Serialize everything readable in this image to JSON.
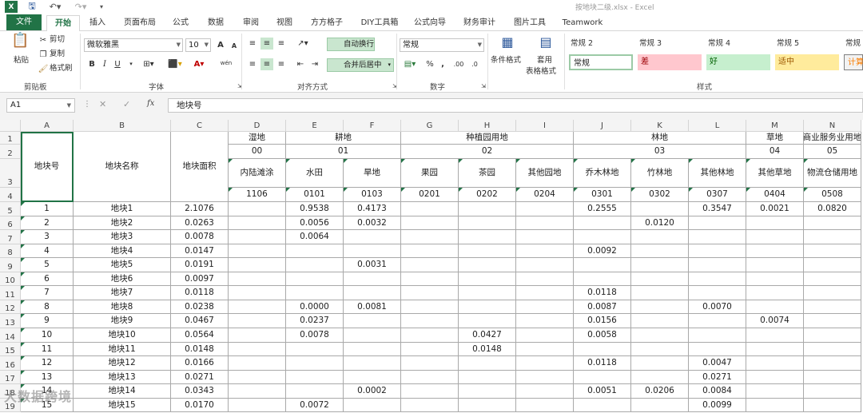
{
  "title_bar": {
    "window_title": "按地块二级.xlsx - Excel",
    "quick_access": [
      "excel-logo-icon",
      "save-icon",
      "undo-icon",
      "redo-icon",
      "customize-icon"
    ]
  },
  "ribbon_tabs": [
    "文件",
    "开始",
    "插入",
    "页面布局",
    "公式",
    "数据",
    "审阅",
    "视图",
    "方方格子",
    "DIY工具箱",
    "公式向导",
    "财务审计",
    "图片工具",
    "Teamwork"
  ],
  "ribbon": {
    "clipboard": {
      "paste": "粘贴",
      "cut": "剪切",
      "copy": "复制",
      "format_painter": "格式刷",
      "group_label": "剪贴板"
    },
    "font": {
      "name": "微软雅黑",
      "size": "10",
      "group_label": "字体",
      "bold": "B",
      "italic": "I",
      "underline": "U",
      "grow": "A",
      "shrink": "A",
      "wen": "wén"
    },
    "alignment": {
      "wrap": "自动换行",
      "merge": "合并后居中",
      "group_label": "对齐方式"
    },
    "number": {
      "format": "常规",
      "percent": "%",
      "comma": ",",
      "group_label": "数字"
    },
    "styles": {
      "conditional": "条件格式",
      "table": "套用",
      "table2": "表格格式",
      "group_label": "样式",
      "headers": [
        "常规 2",
        "常规 3",
        "常规 4",
        "常规 5",
        "常规"
      ],
      "cells": [
        {
          "label": "常规",
          "bg": "#ffffff",
          "color": "#222222"
        },
        {
          "label": "差",
          "bg": "#ffc7ce",
          "color": "#9c0006"
        },
        {
          "label": "好",
          "bg": "#c6efce",
          "color": "#006100"
        },
        {
          "label": "适中",
          "bg": "#ffeb9c",
          "color": "#9c5700"
        },
        {
          "label": "计算",
          "bg": "#f2f2f2",
          "color": "#fa7d00"
        }
      ]
    }
  },
  "formula_bar": {
    "name_box": "A1",
    "fx": "fx",
    "formula": "地块号"
  },
  "columns": [
    "A",
    "B",
    "C",
    "D",
    "E",
    "F",
    "G",
    "H",
    "I",
    "J",
    "K",
    "L",
    "M",
    "N"
  ],
  "rows": [
    "1",
    "2",
    "3",
    "4",
    "5",
    "6",
    "7",
    "8",
    "9",
    "10",
    "11",
    "12",
    "13",
    "14",
    "15",
    "16",
    "17",
    "18",
    "19"
  ],
  "header": {
    "a": "地块号",
    "b": "地块名称",
    "c": "地块面积",
    "row1": [
      "湿地",
      "耕地",
      "种植园用地",
      "林地",
      "草地",
      "商业服务业用地"
    ],
    "row2": [
      "00",
      "01",
      "02",
      "03",
      "04",
      "05"
    ],
    "row3": [
      "内陆滩涂",
      "水田",
      "旱地",
      "果园",
      "茶园",
      "其他园地",
      "乔木林地",
      "竹林地",
      "其他林地",
      "其他草地",
      "物流仓储用地"
    ],
    "row4": [
      "1106",
      "0101",
      "0103",
      "0201",
      "0202",
      "0204",
      "0301",
      "0302",
      "0307",
      "0404",
      "0508"
    ]
  },
  "data_rows": [
    [
      "1",
      "地块1",
      "2.1076",
      "",
      "0.9538",
      "0.4173",
      "",
      "",
      "",
      "0.2555",
      "",
      "0.3547",
      "0.0021",
      "0.0820"
    ],
    [
      "2",
      "地块2",
      "0.0263",
      "",
      "0.0056",
      "0.0032",
      "",
      "",
      "",
      "",
      "0.0120",
      "",
      "",
      ""
    ],
    [
      "3",
      "地块3",
      "0.0078",
      "",
      "0.0064",
      "",
      "",
      "",
      "",
      "",
      "",
      "",
      "",
      ""
    ],
    [
      "4",
      "地块4",
      "0.0147",
      "",
      "",
      "",
      "",
      "",
      "",
      "0.0092",
      "",
      "",
      "",
      ""
    ],
    [
      "5",
      "地块5",
      "0.0191",
      "",
      "",
      "0.0031",
      "",
      "",
      "",
      "",
      "",
      "",
      "",
      ""
    ],
    [
      "6",
      "地块6",
      "0.0097",
      "",
      "",
      "",
      "",
      "",
      "",
      "",
      "",
      "",
      "",
      ""
    ],
    [
      "7",
      "地块7",
      "0.0118",
      "",
      "",
      "",
      "",
      "",
      "",
      "0.0118",
      "",
      "",
      "",
      ""
    ],
    [
      "8",
      "地块8",
      "0.0238",
      "",
      "0.0000",
      "0.0081",
      "",
      "",
      "",
      "0.0087",
      "",
      "0.0070",
      "",
      ""
    ],
    [
      "9",
      "地块9",
      "0.0467",
      "",
      "0.0237",
      "",
      "",
      "",
      "",
      "0.0156",
      "",
      "",
      "0.0074",
      ""
    ],
    [
      "10",
      "地块10",
      "0.0564",
      "",
      "0.0078",
      "",
      "",
      "0.0427",
      "",
      "0.0058",
      "",
      "",
      "",
      ""
    ],
    [
      "11",
      "地块11",
      "0.0148",
      "",
      "",
      "",
      "",
      "0.0148",
      "",
      "",
      "",
      "",
      "",
      ""
    ],
    [
      "12",
      "地块12",
      "0.0166",
      "",
      "",
      "",
      "",
      "",
      "",
      "0.0118",
      "",
      "0.0047",
      "",
      ""
    ],
    [
      "13",
      "地块13",
      "0.0271",
      "",
      "",
      "",
      "",
      "",
      "",
      "",
      "",
      "0.0271",
      "",
      ""
    ],
    [
      "14",
      "地块14",
      "0.0343",
      "",
      "",
      "0.0002",
      "",
      "",
      "",
      "0.0051",
      "0.0206",
      "0.0084",
      "",
      ""
    ],
    [
      "15",
      "地块15",
      "0.0170",
      "",
      "0.0072",
      "",
      "",
      "",
      "",
      "",
      "",
      "0.0099",
      "",
      ""
    ]
  ],
  "watermark": "大数据跨境"
}
